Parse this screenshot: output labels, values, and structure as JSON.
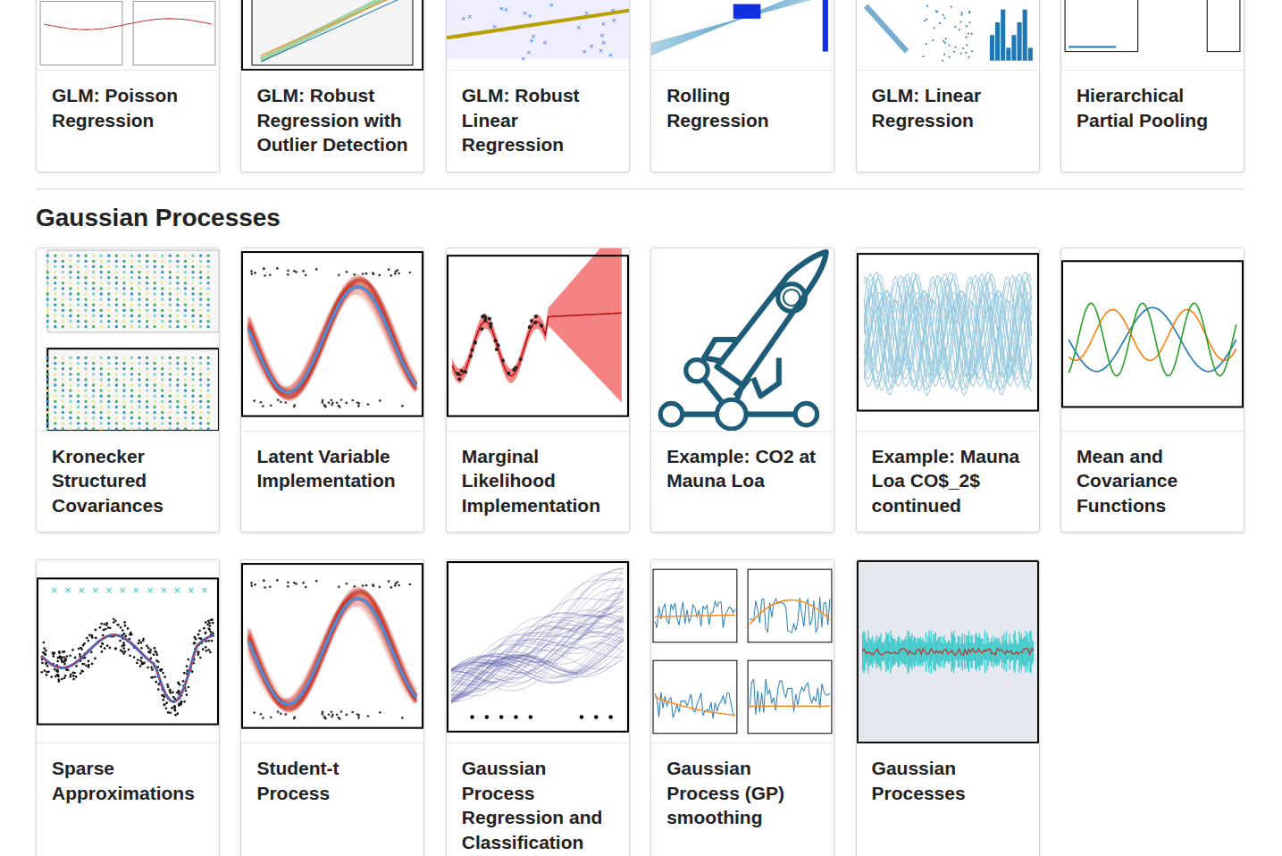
{
  "top_row": [
    {
      "title": "GLM: Poisson Regression",
      "kind": "panels",
      "hovered": false
    },
    {
      "title": "GLM: Robust Regression with Outlier Detection",
      "kind": "fit",
      "hovered": true
    },
    {
      "title": "GLM: Robust Linear Regression",
      "kind": "scatterline",
      "hovered": false
    },
    {
      "title": "Rolling Regression",
      "kind": "rolling",
      "hovered": false
    },
    {
      "title": "GLM: Linear Regression",
      "kind": "pairs",
      "hovered": false
    },
    {
      "title": "Hierarchical Partial Pooling",
      "kind": "hist",
      "hovered": false
    }
  ],
  "section": {
    "title": "Gaussian Processes"
  },
  "cards": [
    {
      "title": "Kronecker Structured Covariances",
      "kind": "grid",
      "hovered": false
    },
    {
      "title": "Latent Variable Implementation",
      "kind": "band",
      "hovered": false
    },
    {
      "title": "Marginal Likelihood Implementation",
      "kind": "predictive",
      "hovered": false
    },
    {
      "title": "Example: CO2 at Mauna Loa",
      "kind": "rocket",
      "hovered": false
    },
    {
      "title": "Example: Mauna Loa CO$_2$ continued",
      "kind": "spaghetti",
      "hovered": false
    },
    {
      "title": "Mean and Covariance Functions",
      "kind": "curves",
      "hovered": false
    },
    {
      "title": "Sparse Approximations",
      "kind": "scatterfit",
      "hovered": false
    },
    {
      "title": "Student-t Process",
      "kind": "band",
      "hovered": false
    },
    {
      "title": "Gaussian Process Regression and Classification",
      "kind": "draws",
      "hovered": false
    },
    {
      "title": "Gaussian Process (GP) smoothing",
      "kind": "smoothing",
      "hovered": false
    },
    {
      "title": "Gaussian Processes",
      "kind": "noise",
      "hovered": true
    }
  ]
}
